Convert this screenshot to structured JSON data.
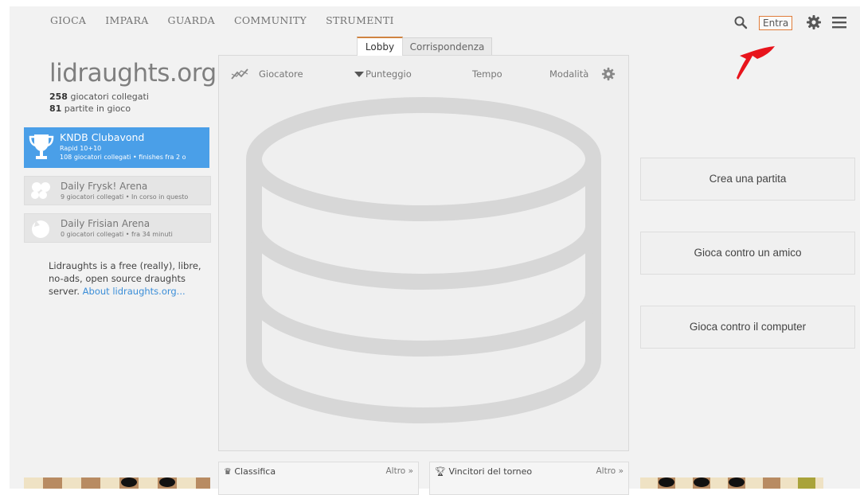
{
  "nav": {
    "items": [
      "GIOCA",
      "IMPARA",
      "GUARDA",
      "COMMUNITY",
      "STRUMENTI"
    ],
    "login_label": "Entra"
  },
  "tabs": {
    "lobby": "Lobby",
    "correspondence": "Corrispondenza"
  },
  "site": {
    "logo": "lidraughts.org",
    "players_count": "258",
    "players_label": " giocatori collegati",
    "games_count": "81",
    "games_label": " partite in gioco"
  },
  "tournaments": [
    {
      "name": "KNDB Clubavond",
      "line2": "Rapid 10+10",
      "line3": "108 giocatori collegati • finishes  fra 2 o"
    },
    {
      "name": "Daily Frysk! Arena",
      "line2": "9 giocatori collegati • In corso in questo"
    },
    {
      "name": "Daily Frisian Arena",
      "line2": "0 giocatori collegati •  fra 34 minuti"
    }
  ],
  "about": {
    "text": "Lidraughts is a free (really), libre, no-ads, open source draughts server. ",
    "link": "About lidraughts.org..."
  },
  "lobby_head": {
    "player": "Giocatore",
    "rating": "Punteggio",
    "time": "Tempo",
    "mode": "Modalità"
  },
  "actions": {
    "create_game": "Crea una partita",
    "play_friend": "Gioca contro un amico",
    "play_computer": "Gioca contro il computer"
  },
  "bottom": {
    "leaderboard": "Classifica",
    "leaderboard_more": "Altro »",
    "winners": "Vincitori del torneo",
    "winners_more": "Altro »"
  },
  "colors": {
    "accent_orange": "#d08441",
    "tournament_blue": "#4a9fe8",
    "annotation_red": "#e8141c"
  }
}
